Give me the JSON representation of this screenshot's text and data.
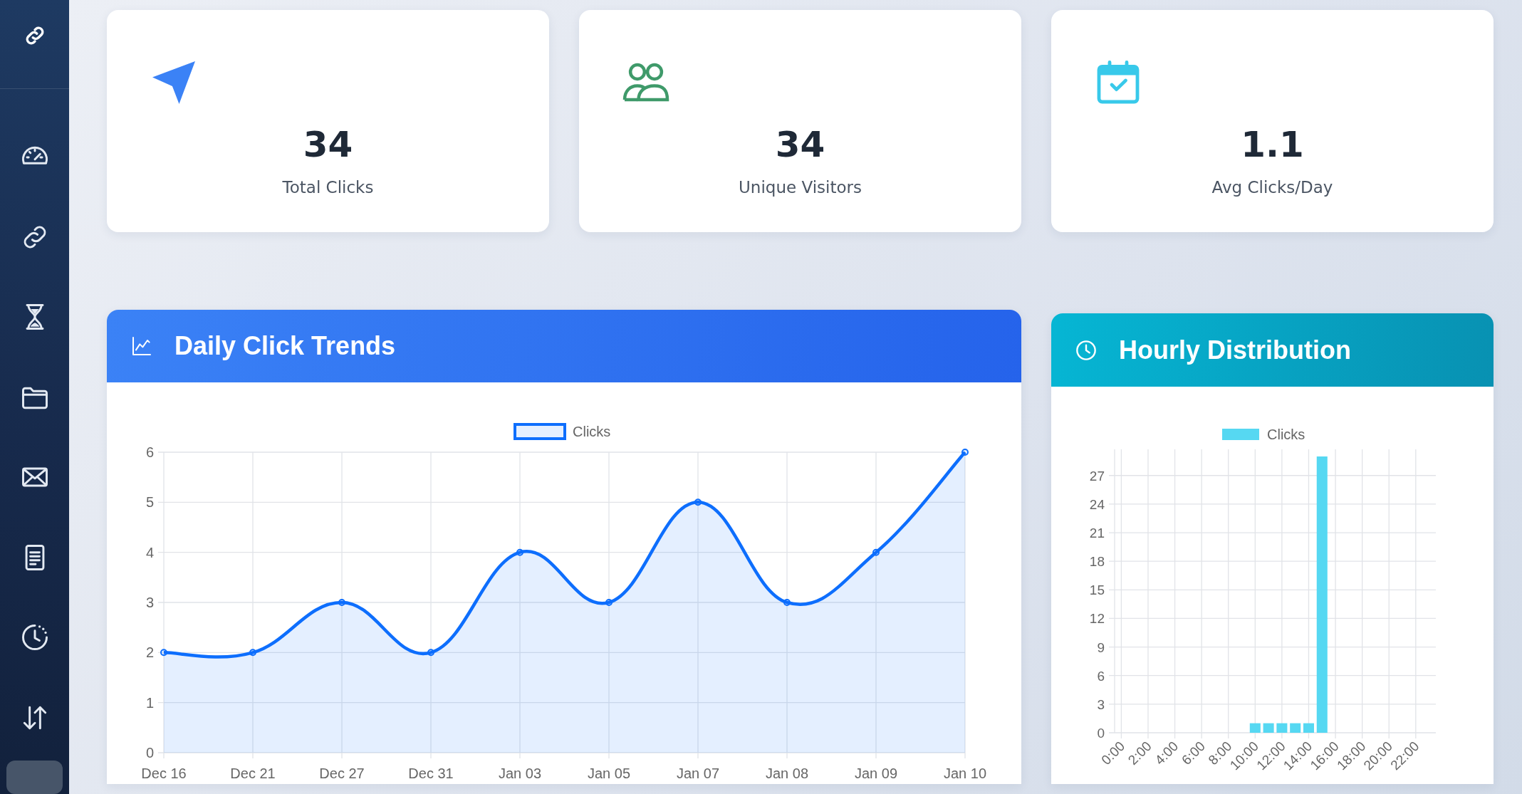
{
  "stats": [
    {
      "kind": "navigation",
      "value": "34",
      "label": "Total Clicks"
    },
    {
      "kind": "people",
      "value": "34",
      "label": "Unique Visitors"
    },
    {
      "kind": "calendar",
      "value": "1.1",
      "label": "Avg Clicks/Day"
    }
  ],
  "charts": [
    {
      "kind": "trend",
      "title": "Daily Click Trends",
      "chart_data": {
        "type": "area",
        "grid": true,
        "categories": [
          "Dec 16",
          "Dec 21",
          "Dec 27",
          "Dec 31",
          "Jan 03",
          "Jan 05",
          "Jan 07",
          "Jan 08",
          "Jan 09",
          "Jan 10"
        ],
        "series": [
          {
            "name": "Clicks",
            "color": "#0d6efd",
            "marker": "circle",
            "values": [
              2,
              2,
              3,
              2,
              4,
              3,
              5,
              3,
              4,
              6
            ]
          }
        ],
        "ylim": [
          0,
          6
        ],
        "yticks": [
          0,
          1,
          2,
          3,
          4,
          5,
          6
        ]
      }
    },
    {
      "kind": "clock",
      "title": "Hourly Distribution",
      "chart_data": {
        "type": "bar",
        "grid": true,
        "xlim": [
          -0.5,
          23.5
        ],
        "x": [
          0,
          1,
          2,
          3,
          4,
          5,
          6,
          7,
          8,
          9,
          10,
          11,
          12,
          13,
          14,
          15,
          16,
          17,
          18,
          19,
          20,
          21,
          22,
          23
        ],
        "xticks": [
          {
            "value": 0,
            "label": "0:00"
          },
          {
            "value": 2,
            "label": "2:00"
          },
          {
            "value": 4,
            "label": "4:00"
          },
          {
            "value": 6,
            "label": "6:00"
          },
          {
            "value": 8,
            "label": "8:00"
          },
          {
            "value": 10,
            "label": "10:00"
          },
          {
            "value": 12,
            "label": "12:00"
          },
          {
            "value": 14,
            "label": "14:00"
          },
          {
            "value": 16,
            "label": "16:00"
          },
          {
            "value": 18,
            "label": "18:00"
          },
          {
            "value": 20,
            "label": "20:00"
          },
          {
            "value": 22,
            "label": "22:00"
          }
        ],
        "series": [
          {
            "name": "Clicks",
            "color": "#56d8f2",
            "values": [
              0,
              0,
              0,
              0,
              0,
              0,
              0,
              0,
              0,
              0,
              1,
              1,
              1,
              1,
              1,
              29,
              0,
              0,
              0,
              0,
              0,
              0,
              0,
              0
            ]
          }
        ],
        "ylim": [
          0,
          29
        ],
        "yticks": [
          0,
          3,
          6,
          9,
          12,
          15,
          18,
          21,
          24,
          27
        ]
      }
    }
  ]
}
